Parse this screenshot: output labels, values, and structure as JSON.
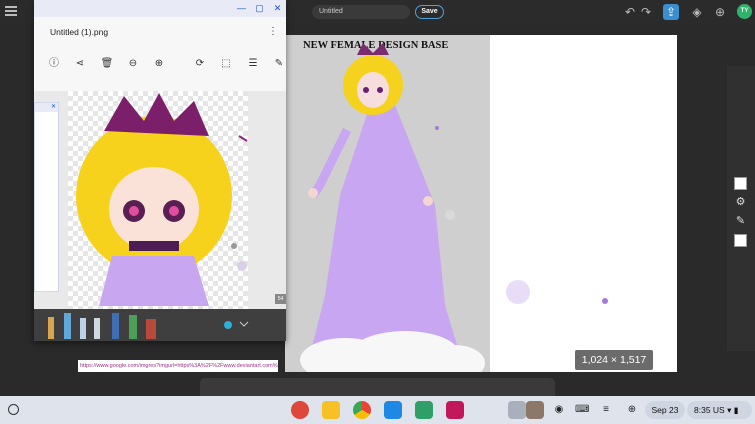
{
  "drawing_app": {
    "doc_title": "Untitled",
    "save_label": "Save",
    "avatar_initials": "TY",
    "canvas_heading": "NEW FEMALE DESIGN BASE",
    "dimensions": "1,024 × 1,517",
    "url_text": "https://www.google.com/imgres?imgurl=https%3A%2F%2Fwww.deviantart.com%2F...",
    "top_icons": [
      "undo-icon",
      "redo-icon",
      "share-icon",
      "layers-icon",
      "add-icon"
    ]
  },
  "image_viewer": {
    "file_name": "Untitled (1).png",
    "window_controls": [
      "minimize",
      "maximize",
      "close"
    ],
    "toolbar": [
      "info-icon",
      "share-icon",
      "delete-icon",
      "zoom-out-icon",
      "zoom-in-icon",
      "rotate-icon",
      "crop-icon",
      "adjust-icon",
      "draw-icon"
    ],
    "size_badge": "54"
  },
  "shelf": {
    "date": "Sep 23",
    "time": "8:35",
    "region": "US",
    "apps": [
      "drawing-app",
      "keep-app",
      "chrome-app",
      "camera-app",
      "files-app",
      "gallery-app"
    ],
    "colors": {
      "drawing": "#e0473c",
      "keep": "#f6c026",
      "chrome": "#4285f4",
      "camera": "#1e88e5",
      "files": "#2e9f67",
      "gallery": "#c2185b"
    }
  }
}
